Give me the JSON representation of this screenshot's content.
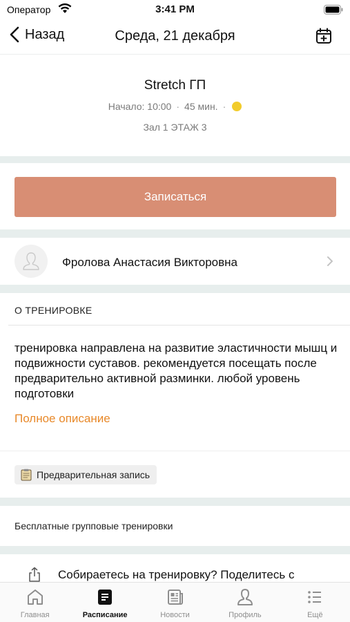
{
  "status_bar": {
    "carrier": "Оператор",
    "time": "3:41 PM"
  },
  "nav": {
    "back_label": "Назад",
    "title": "Среда, 21 декабря"
  },
  "class": {
    "title": "Stretch ГП",
    "start": "Начало: 10:00",
    "duration": "45 мин.",
    "status_color": "#f2cc2c",
    "room": "Зал 1 ЭТАЖ 3"
  },
  "signup_label": "Записаться",
  "trainer": {
    "name": "Фролова Анастасия Викторовна"
  },
  "about": {
    "header": "О ТРЕНИРОВКЕ",
    "description": "тренировка направлена на развитие эластичности мышц и подвижности суставов. рекомендуется посещать после предварительно активной разминки. любой уровень подготовки",
    "full_link": "Полное описание"
  },
  "tag": {
    "label": "Предварительная запись"
  },
  "free_label": "Бесплатные групповые тренировки",
  "share": {
    "text": "Собираетесь на тренировку? Поделитесь с"
  },
  "tabs": [
    {
      "label": "Главная",
      "icon": "home-icon"
    },
    {
      "label": "Расписание",
      "icon": "schedule-icon",
      "active": true
    },
    {
      "label": "Новости",
      "icon": "news-icon"
    },
    {
      "label": "Профиль",
      "icon": "profile-icon"
    },
    {
      "label": "Ещё",
      "icon": "more-list-icon"
    }
  ],
  "colors": {
    "accent": "#d88e74",
    "link": "#e8892a",
    "section_gap": "#e7eeed"
  }
}
